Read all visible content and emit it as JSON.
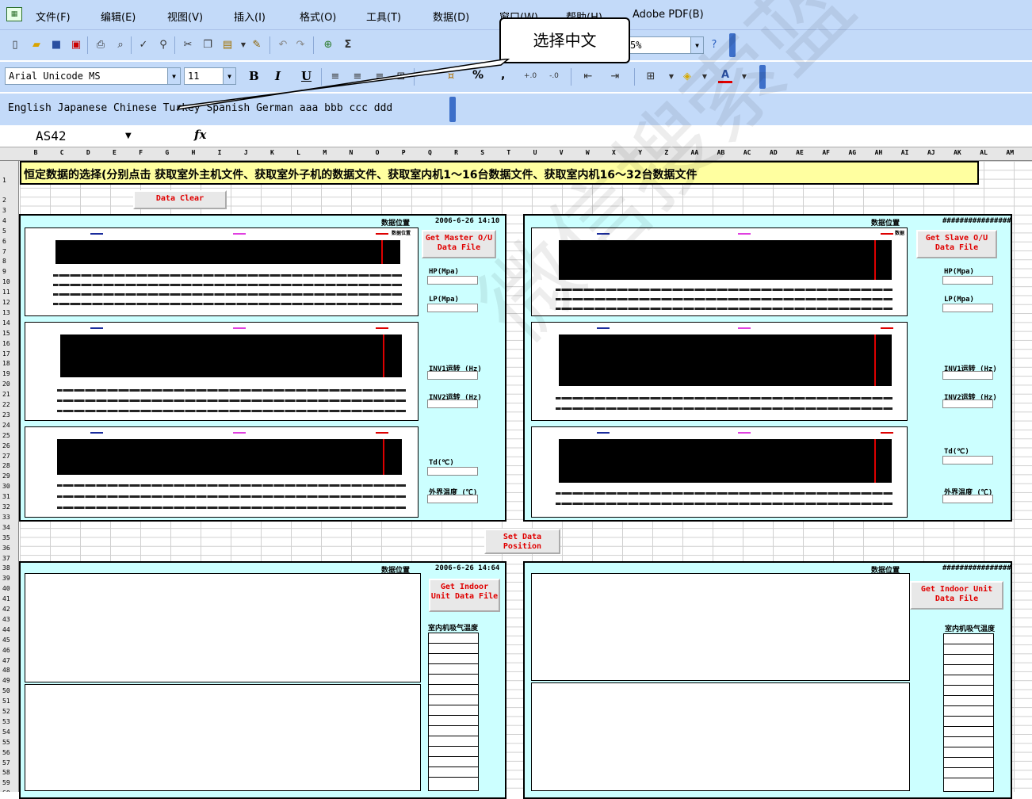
{
  "menu": [
    "文件(F)",
    "编辑(E)",
    "视图(V)",
    "插入(I)",
    "格式(O)",
    "工具(T)",
    "数据(D)",
    "窗口(W)",
    "帮助(H)",
    "Adobe PDF(B)"
  ],
  "toolbar": {
    "zoom": "5%",
    "font_name": "Arial Unicode MS",
    "font_size": "11",
    "bold": "B",
    "italic": "I",
    "underline": "U",
    "percent": "%",
    "comma": ","
  },
  "language_bar": "English Japanese Chinese Turkey Spanish German aaa bbb ccc ddd",
  "callout": "选择中文",
  "formula_bar": {
    "name_box": "AS42",
    "fx": "fx"
  },
  "columns": [
    "B",
    "C",
    "D",
    "E",
    "F",
    "G",
    "H",
    "I",
    "J",
    "K",
    "L",
    "M",
    "N",
    "O",
    "P",
    "Q",
    "R",
    "S",
    "T",
    "U",
    "V",
    "W",
    "X",
    "Y",
    "Z",
    "AA",
    "AB",
    "AC",
    "AD",
    "AE",
    "AF",
    "AG",
    "AH",
    "AI",
    "AJ",
    "AK",
    "AL",
    "AM"
  ],
  "sheet": {
    "title": "恒定数据的选择(分别点击 获取室外主机文件、获取室外子机的数据文件、获取室内机1～16台数据文件、获取室内机16～32台数据文件",
    "data_clear": "Data Clear",
    "set_data_position": "Set Data Position"
  },
  "panel_master": {
    "position_label": "数据位置",
    "timestamp": "2006-6-26 14:10",
    "button": "Get Master O/U Data File",
    "hp": "HP(Mpa)",
    "lp": "LP(Mpa)",
    "inv1": "INV1运转 (Hz)",
    "inv2": "INV2运转 (Hz)",
    "td": "Td(℃)",
    "outdoor_temp": "外界温度 (℃)",
    "legend_end": "数据位置"
  },
  "panel_slave": {
    "position_label": "数据位置",
    "timestamp": "################",
    "button": "Get Slave O/U Data File",
    "hp": "HP(Mpa)",
    "lp": "LP(Mpa)",
    "inv1": "INV1运转 (Hz)",
    "inv2": "INV2运转 (Hz)",
    "td": "Td(℃)",
    "outdoor_temp": "外界温度 (℃)",
    "legend_end": "数据"
  },
  "panel_indoor1": {
    "position_label": "数据位置",
    "timestamp": "2006-6-26 14:64",
    "button": "Get Indoor Unit Data File",
    "room_temp": "室内机吸气温度"
  },
  "panel_indoor2": {
    "position_label": "数据位置",
    "timestamp": "################",
    "button": "Get Indoor Unit Data File",
    "room_temp": "室内机吸气温度"
  },
  "watermark": "微信搜索蓝色星球"
}
